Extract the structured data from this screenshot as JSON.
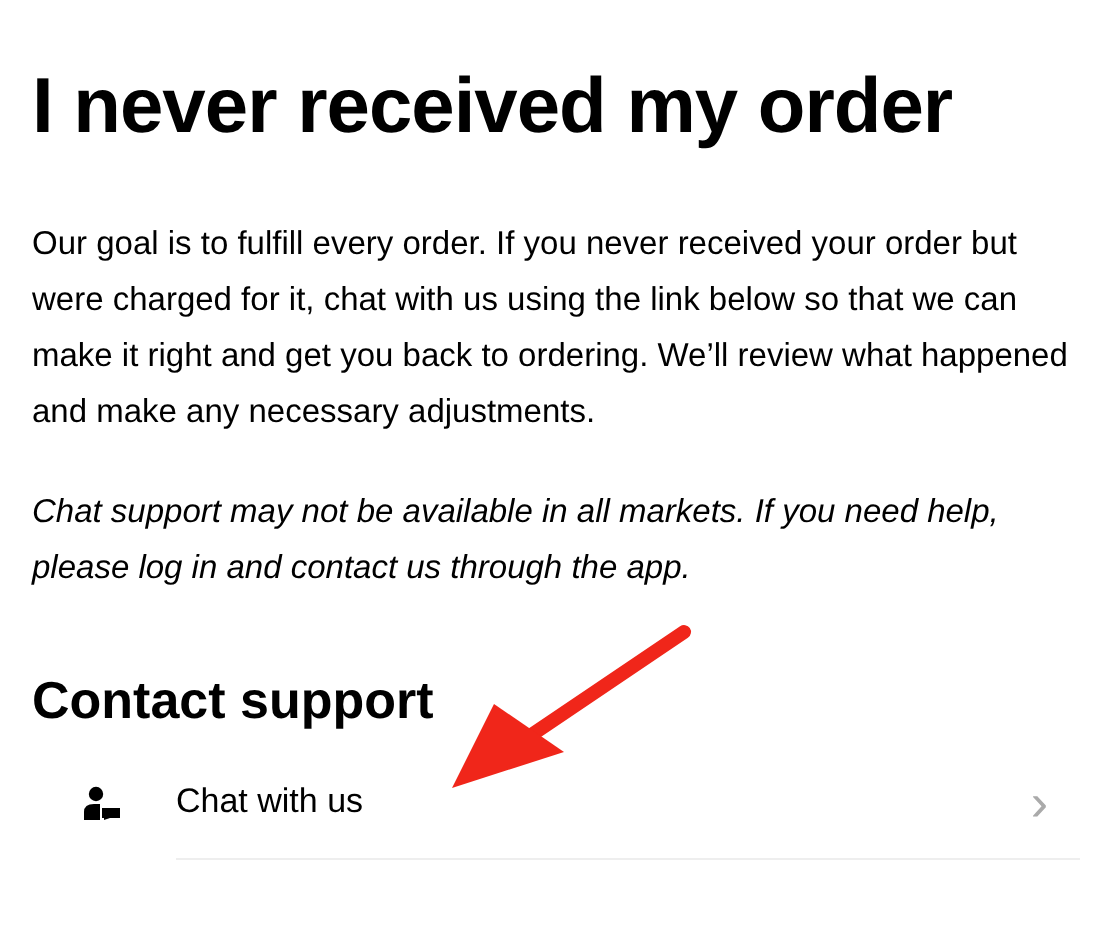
{
  "title": "I never received my order",
  "body": "Our goal is to fulfill every order. If you never received your order but were charged for it, chat with us using the link below so that we can make it right and get you back to ordering. We’ll review what happened and make any necessary adjustments.",
  "note": "Chat support may not be available in all markets. If you need help, please log in and contact us through the app.",
  "section_heading": "Contact support",
  "links": [
    {
      "label": "Chat with us",
      "chevron": "›"
    }
  ]
}
